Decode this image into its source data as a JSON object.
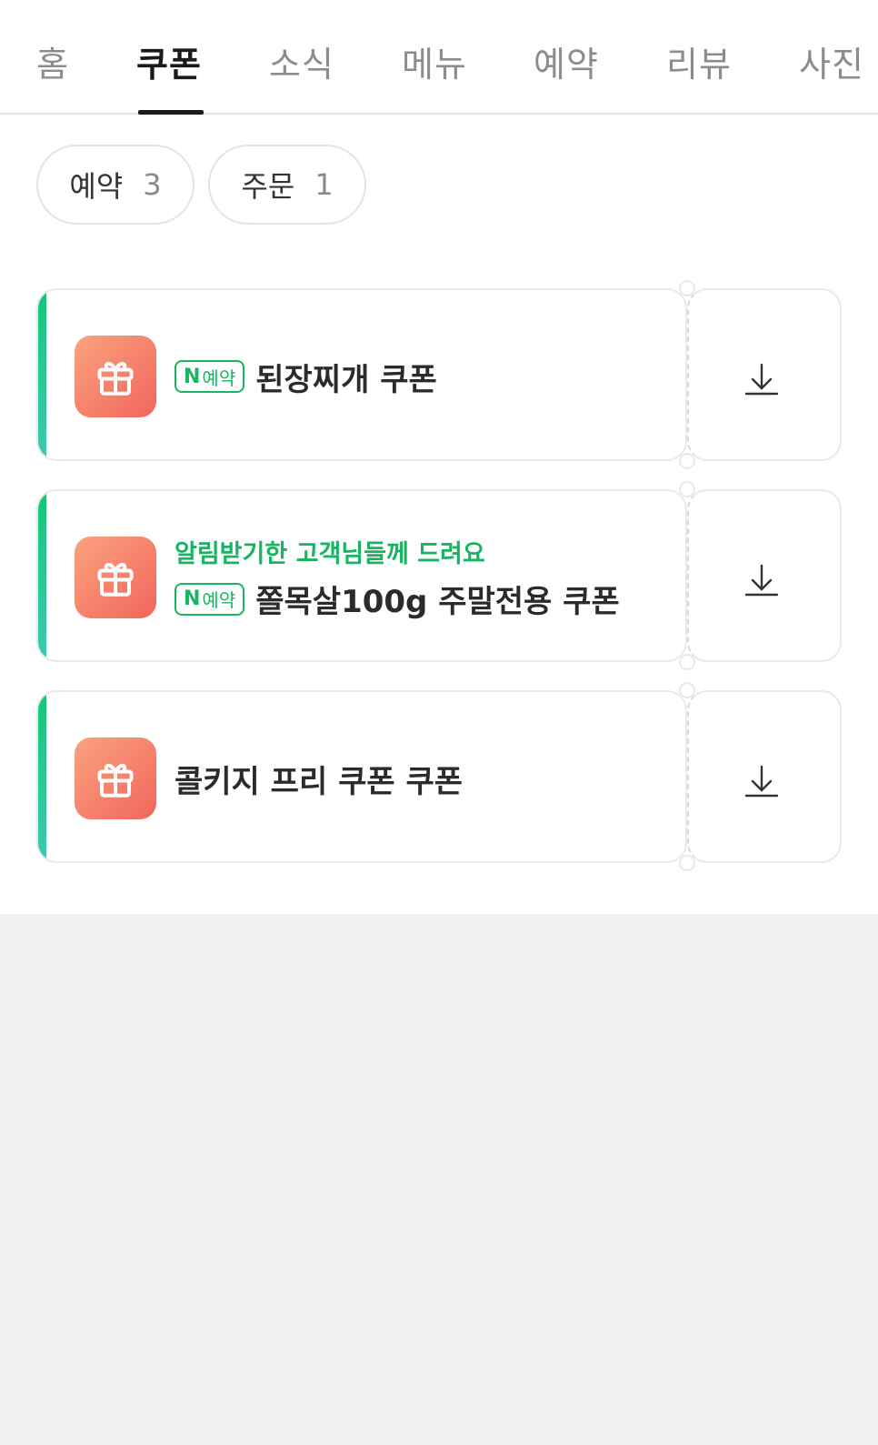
{
  "tabs": [
    {
      "label": "홈"
    },
    {
      "label": "쿠폰"
    },
    {
      "label": "소식"
    },
    {
      "label": "메뉴"
    },
    {
      "label": "예약"
    },
    {
      "label": "리뷰"
    },
    {
      "label": "사진"
    }
  ],
  "active_tab": "쿠폰",
  "filters": [
    {
      "label": "예약",
      "count": "3"
    },
    {
      "label": "주문",
      "count": "1"
    }
  ],
  "coupons": [
    {
      "notice": "",
      "badge_n": "N",
      "badge_text": "예약",
      "title": "된장찌개 쿠폰"
    },
    {
      "notice": "알림받기한 고객님들께 드려요",
      "badge_n": "N",
      "badge_text": "예약",
      "title": "쫄목살100g 주말전용 쿠폰"
    },
    {
      "notice": "",
      "badge_n": "",
      "badge_text": "",
      "title": "콜키지 프리 쿠폰 쿠폰"
    }
  ],
  "icons": {
    "coupon": "gift-icon",
    "download": "download-icon"
  },
  "colors": {
    "accent_green": "#17b562",
    "gift_gradient_start": "#fba27e",
    "gift_gradient_end": "#f1665c",
    "background": "#eff0f2"
  }
}
